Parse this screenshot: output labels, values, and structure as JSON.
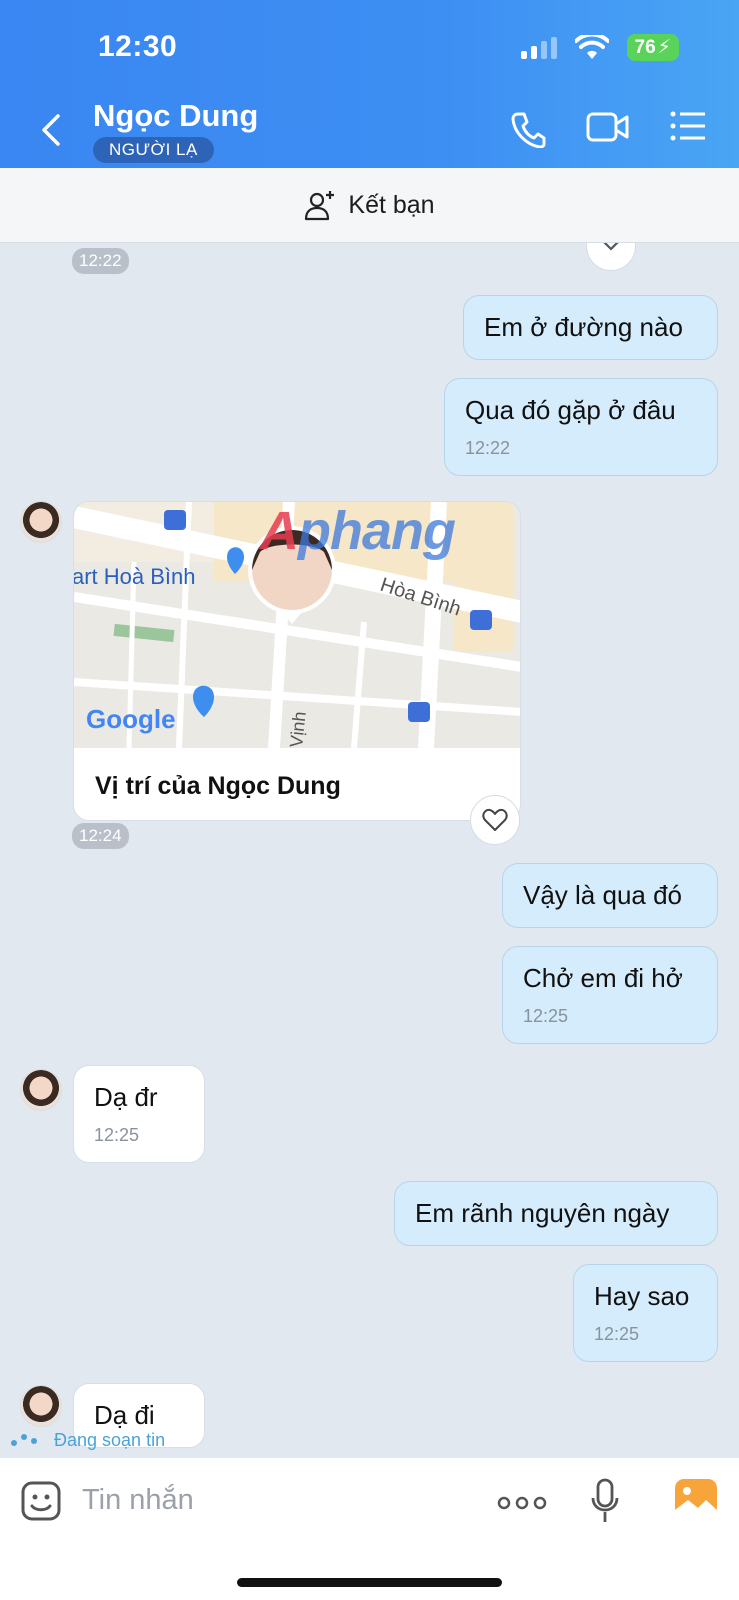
{
  "status_bar": {
    "time": "12:30",
    "battery": "76"
  },
  "header": {
    "name": "Ngọc Dung",
    "badge": "NGƯỜI LẠ"
  },
  "add_friend": {
    "label": "Kết bạn"
  },
  "messages": {
    "time_top": "12:22",
    "m1": {
      "text": "Em ở đường nào"
    },
    "m2": {
      "text": "Qua đó gặp ở đâu",
      "time": "12:22"
    },
    "location": {
      "label": "Vị trí của Ngọc Dung",
      "time": "12:24",
      "map_labels": {
        "street1": "Hòa Bình",
        "street2": "Vịnh",
        "poi": "art Hoà Bình",
        "logo": "Google"
      }
    },
    "m3": {
      "text": "Vậy là qua đó"
    },
    "m4": {
      "text": "Chở em đi hở",
      "time": "12:25"
    },
    "m5": {
      "text": "Dạ đr",
      "time": "12:25"
    },
    "m6": {
      "text": "Em rãnh nguyên ngày"
    },
    "m7": {
      "text": "Hay sao",
      "time": "12:25"
    },
    "m8": {
      "text": "Dạ đi"
    }
  },
  "watermark": {
    "a": "A",
    "rest": "phang"
  },
  "typing": "Đang soạn tin",
  "input": {
    "placeholder": "Tin nhắn"
  }
}
